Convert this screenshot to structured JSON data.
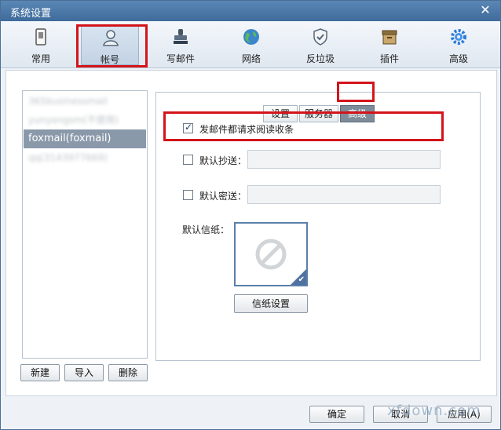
{
  "window": {
    "title": "系统设置",
    "close_icon": "close-icon"
  },
  "toolbar": {
    "items": [
      {
        "label": "常用",
        "icon": "phone-icon"
      },
      {
        "label": "帐号",
        "icon": "user-icon"
      },
      {
        "label": "写邮件",
        "icon": "stamp-icon"
      },
      {
        "label": "网络",
        "icon": "globe-icon"
      },
      {
        "label": "反垃圾",
        "icon": "shield-icon"
      },
      {
        "label": "插件",
        "icon": "box-icon"
      },
      {
        "label": "高级",
        "icon": "gear-icon"
      }
    ]
  },
  "accounts": {
    "items": [
      {
        "label": "365businessmail"
      },
      {
        "label": "yunyongsm(不使用)"
      },
      {
        "label": "foxmail(foxmail)"
      },
      {
        "label": "qq(3143977669)"
      }
    ],
    "selected": "foxmail(foxmail)",
    "buttons": {
      "new": "新建",
      "import": "导入",
      "delete": "删除"
    }
  },
  "tabs": [
    {
      "label": "设置"
    },
    {
      "label": "服务器"
    },
    {
      "label": "高级"
    }
  ],
  "advanced": {
    "read_receipt_label": "发邮件都请求阅读收条",
    "read_receipt_checked": true,
    "cc_label": "默认抄送：",
    "cc_value": "",
    "bcc_label": "默认密送：",
    "bcc_value": "",
    "stationery_label": "默认信纸：",
    "stationery_button": "信纸设置"
  },
  "footer": {
    "ok": "确定",
    "cancel": "取消",
    "apply": "应用(A)"
  },
  "watermark": "xfdown.com",
  "colors": {
    "title_bar": "#4a77a8",
    "highlight": "#d4141b",
    "selected_row": "#8a99aa"
  }
}
